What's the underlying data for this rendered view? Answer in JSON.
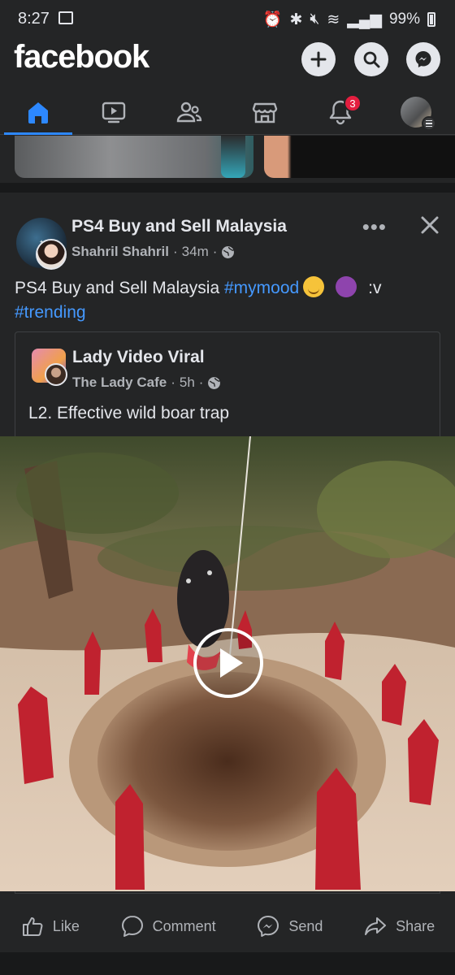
{
  "status_bar": {
    "time": "8:27",
    "battery": "99%"
  },
  "header": {
    "logo": "facebook"
  },
  "nav": {
    "tabs": [
      "home",
      "video",
      "friends",
      "marketplace",
      "notifications",
      "menu"
    ],
    "notification_count": "3"
  },
  "post": {
    "page_name": "PS4 Buy and Sell Malaysia",
    "author": "Shahril Shahril",
    "time": "34m",
    "separator": "·",
    "more_label": "•••",
    "text_prefix": "PS4 Buy and Sell Malaysia ",
    "hashtag1": "#mymood",
    "text_suffix": ":v",
    "hashtag2": "#trending"
  },
  "shared_post": {
    "page_name": "Lady Video Viral",
    "author": "The Lady Cafe",
    "time": "5h",
    "separator": "·",
    "text": "L2. Effective wild boar trap"
  },
  "actions": {
    "like": "Like",
    "comment": "Comment",
    "send": "Send",
    "share": "Share"
  },
  "colors": {
    "background": "#242526",
    "text": "#e4e6eb",
    "secondary_text": "#b0b3b8",
    "accent": "#2d88ff",
    "badge": "#e41e3f"
  }
}
